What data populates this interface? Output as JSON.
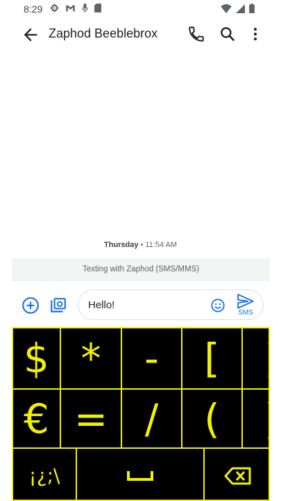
{
  "status_bar": {
    "time": "8:29",
    "left_icons": [
      "settings-gear-icon",
      "gmail-icon",
      "mic-icon",
      "sd-card-icon"
    ],
    "right_icons": [
      "wifi-icon",
      "signal-icon",
      "battery-icon"
    ]
  },
  "app_bar": {
    "title": "Zaphod Beeblebrox",
    "actions": [
      "back-arrow-icon",
      "phone-icon",
      "search-icon",
      "more-vert-icon"
    ]
  },
  "conversation": {
    "day": "Thursday",
    "separator": " • ",
    "time": "11:54 AM",
    "banner": "Texting with Zaphod (SMS/MMS)"
  },
  "compose": {
    "text": "Hello!",
    "send_label": "SMS",
    "accent": "#1a73e8"
  },
  "keyboard": {
    "key_color": "#f2f200",
    "background": "#000000",
    "row1": [
      "$",
      "*",
      "-",
      "[",
      "]"
    ],
    "row2": [
      "€",
      "=",
      "/",
      "(",
      ")"
    ],
    "row3_symbols": "¡¿;\\",
    "space_key": "␣",
    "backspace": "backspace-icon"
  }
}
